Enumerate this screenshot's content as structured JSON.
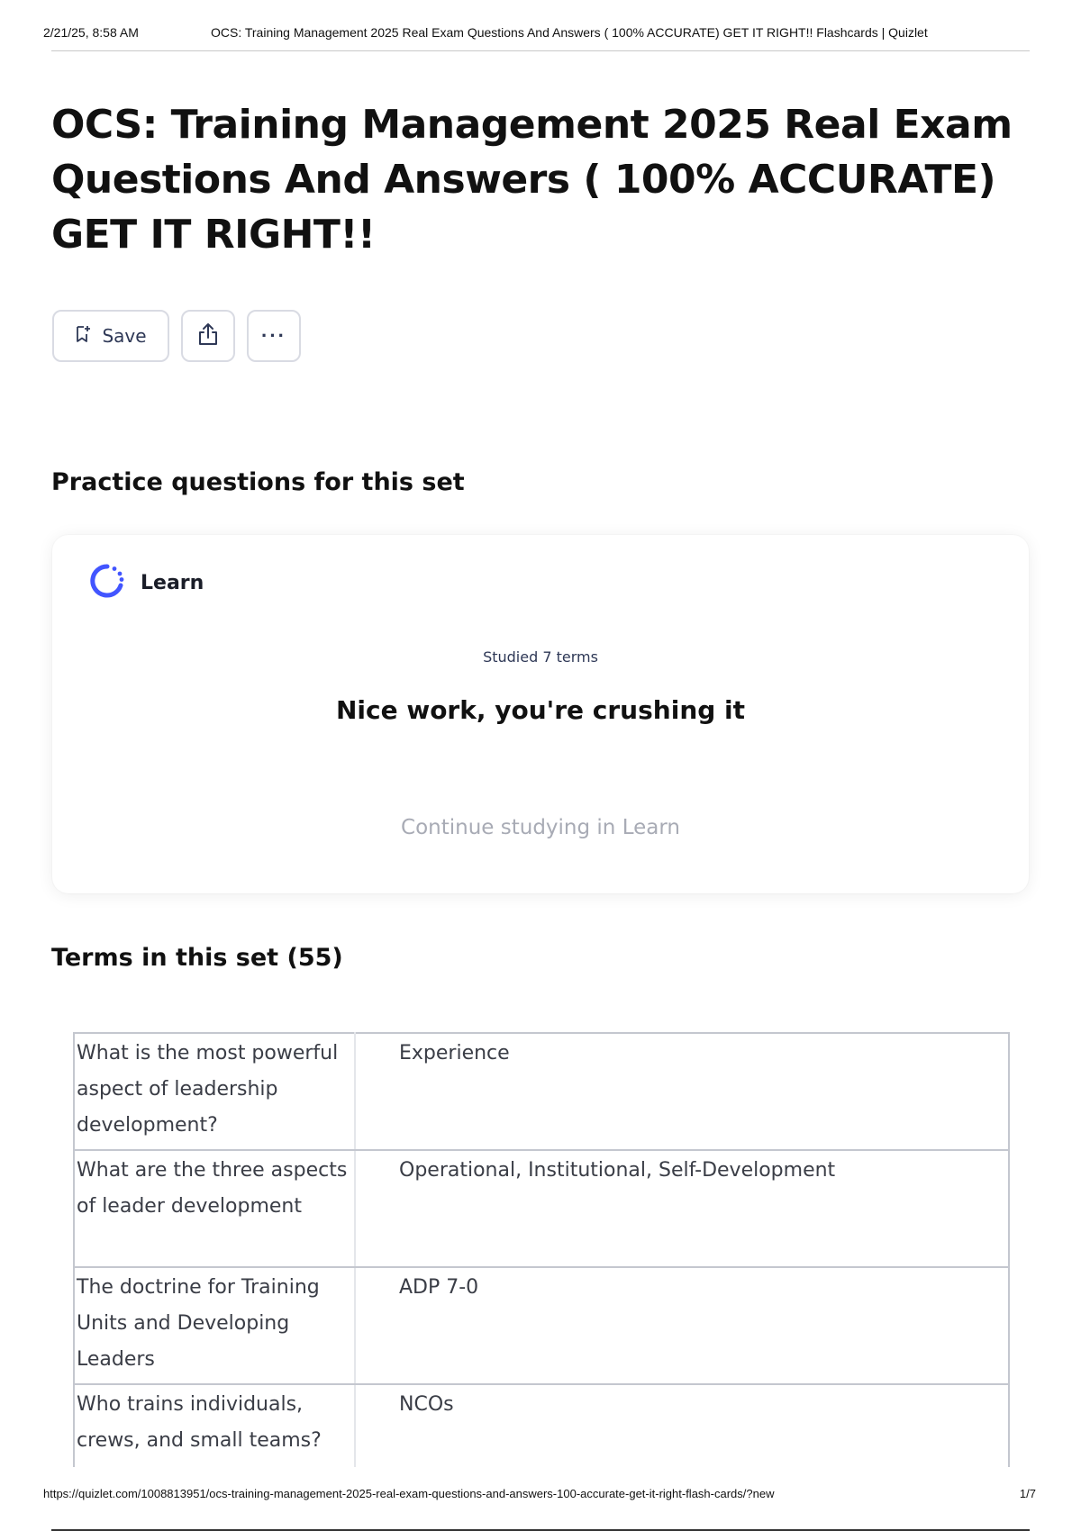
{
  "print_header": {
    "date": "2/21/25, 8:58 AM",
    "doc_title": "OCS: Training Management 2025 Real Exam Questions And Answers ( 100% ACCURATE) GET IT RIGHT!! Flashcards | Quizlet"
  },
  "page_title": "OCS: Training Management 2025 Real Exam Questions And Answers ( 100% ACCURATE) GET IT RIGHT!!",
  "actions": {
    "save_label": "Save",
    "save_icon": "bookmark-plus-icon",
    "share_icon": "share-icon",
    "more_icon": "more-horizontal-icon",
    "more_label": "···"
  },
  "practice": {
    "title": "Practice questions for this set",
    "learn_label": "Learn",
    "learn_icon": "learn-progress-icon",
    "studied_text": "Studied 7 terms",
    "headline": "Nice work, you're crushing it",
    "continue_label": "Continue studying in Learn"
  },
  "terms": {
    "title": "Terms in this set (55)",
    "rows": [
      {
        "term": "What is the most powerful aspect of leadership development?",
        "definition": "Experience"
      },
      {
        "term": "What are the three aspects of leader development",
        "definition": "Operational, Institutional, Self-Development"
      },
      {
        "term": "The doctrine for Training Units and Developing Leaders",
        "definition": "ADP 7-0"
      },
      {
        "term": "Who trains individuals, crews, and small teams?",
        "definition": "NCOs"
      }
    ]
  },
  "print_footer": {
    "url": "https://quizlet.com/1008813951/ocs-training-management-2025-real-exam-questions-and-answers-100-accurate-get-it-right-flash-cards/?new",
    "page": "1/7"
  },
  "colors": {
    "accent": "#4255ff",
    "muted_text": "#a8abb5",
    "border": "#c4c7cf"
  }
}
